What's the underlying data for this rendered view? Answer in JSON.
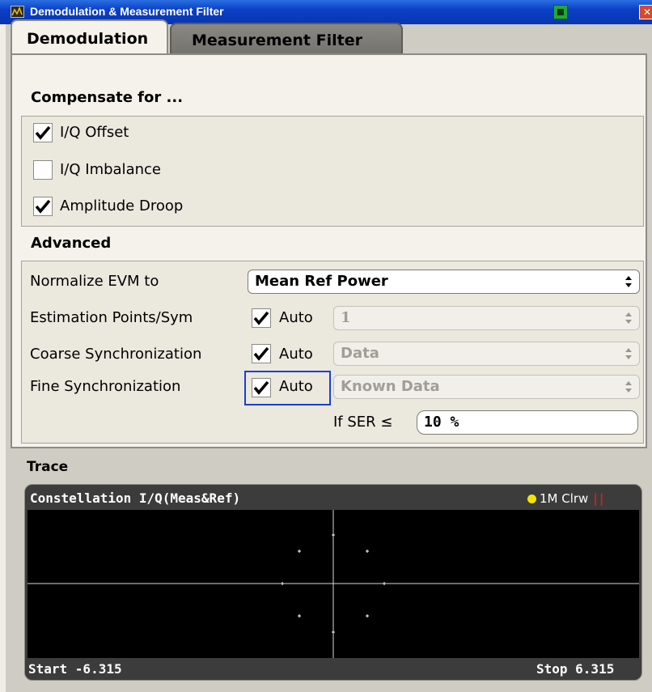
{
  "window": {
    "title": "Demodulation & Measurement Filter",
    "close_glyph": "✕"
  },
  "tabs": [
    {
      "label": "Demodulation",
      "active": true
    },
    {
      "label": "Measurement Filter",
      "active": false
    }
  ],
  "compensate": {
    "heading": "Compensate for ...",
    "items": [
      {
        "label": "I/Q Offset",
        "checked": true
      },
      {
        "label": "I/Q Imbalance",
        "checked": false
      },
      {
        "label": "Amplitude Droop",
        "checked": true
      }
    ]
  },
  "advanced": {
    "heading": "Advanced",
    "normalize": {
      "label": "Normalize EVM to",
      "value": "Mean Ref Power"
    },
    "estimation": {
      "label": "Estimation Points/Sym",
      "auto_label": "Auto",
      "auto_checked": true,
      "value": "1"
    },
    "coarse": {
      "label": "Coarse Synchronization",
      "auto_label": "Auto",
      "auto_checked": true,
      "value": "Data"
    },
    "fine": {
      "label": "Fine Synchronization",
      "auto_label": "Auto",
      "auto_checked": true,
      "value": "Known Data"
    },
    "ser": {
      "label": "If SER ≤",
      "value": "10 %"
    }
  },
  "trace": {
    "heading": "Trace",
    "title": "Constellation I/Q(Meas&Ref)",
    "legend": {
      "text": "1M Clrw",
      "marker": "||",
      "dot_color": "#f3e400"
    },
    "start": "Start -6.315",
    "stop": "Stop 6.315",
    "constellation_points": [
      {
        "i": -1,
        "q": 1
      },
      {
        "i": 1,
        "q": 1
      },
      {
        "i": -1,
        "q": -1
      },
      {
        "i": 1,
        "q": -1
      },
      {
        "i": -1.5,
        "q": 0
      },
      {
        "i": 1.5,
        "q": 0
      },
      {
        "i": 0,
        "q": 1.5
      },
      {
        "i": 0,
        "q": -1.5
      }
    ]
  }
}
